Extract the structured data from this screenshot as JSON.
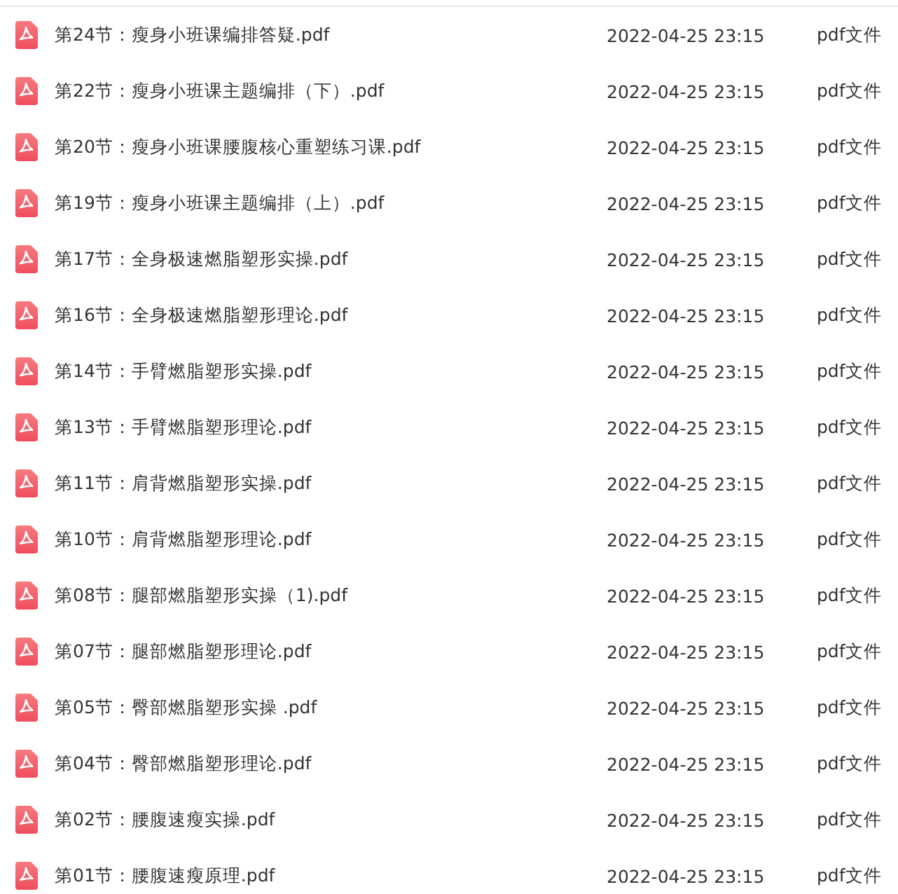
{
  "files": [
    {
      "name": "第24节：瘦身小班课编排答疑.pdf",
      "modified": "2022-04-25 23:15",
      "type": "pdf文件"
    },
    {
      "name": "第22节：瘦身小班课主题编排（下）.pdf",
      "modified": "2022-04-25 23:15",
      "type": "pdf文件"
    },
    {
      "name": "第20节：瘦身小班课腰腹核心重塑练习课.pdf",
      "modified": "2022-04-25 23:15",
      "type": "pdf文件"
    },
    {
      "name": "第19节：瘦身小班课主题编排（上）.pdf",
      "modified": "2022-04-25 23:15",
      "type": "pdf文件"
    },
    {
      "name": "第17节：全身极速燃脂塑形实操.pdf",
      "modified": "2022-04-25 23:15",
      "type": "pdf文件"
    },
    {
      "name": "第16节：全身极速燃脂塑形理论.pdf",
      "modified": "2022-04-25 23:15",
      "type": "pdf文件"
    },
    {
      "name": "第14节：手臂燃脂塑形实操.pdf",
      "modified": "2022-04-25 23:15",
      "type": "pdf文件"
    },
    {
      "name": "第13节：手臂燃脂塑形理论.pdf",
      "modified": "2022-04-25 23:15",
      "type": "pdf文件"
    },
    {
      "name": "第11节：肩背燃脂塑形实操.pdf",
      "modified": "2022-04-25 23:15",
      "type": "pdf文件"
    },
    {
      "name": "第10节：肩背燃脂塑形理论.pdf",
      "modified": "2022-04-25 23:15",
      "type": "pdf文件"
    },
    {
      "name": "第08节：腿部燃脂塑形实操（1).pdf",
      "modified": "2022-04-25 23:15",
      "type": "pdf文件"
    },
    {
      "name": "第07节：腿部燃脂塑形理论.pdf",
      "modified": "2022-04-25 23:15",
      "type": "pdf文件"
    },
    {
      "name": "第05节：臀部燃脂塑形实操 .pdf",
      "modified": "2022-04-25 23:15",
      "type": "pdf文件"
    },
    {
      "name": "第04节：臀部燃脂塑形理论.pdf",
      "modified": "2022-04-25 23:15",
      "type": "pdf文件"
    },
    {
      "name": "第02节：腰腹速瘦实操.pdf",
      "modified": "2022-04-25 23:15",
      "type": "pdf文件"
    },
    {
      "name": "第01节：腰腹速瘦原理.pdf",
      "modified": "2022-04-25 23:15",
      "type": "pdf文件"
    }
  ]
}
